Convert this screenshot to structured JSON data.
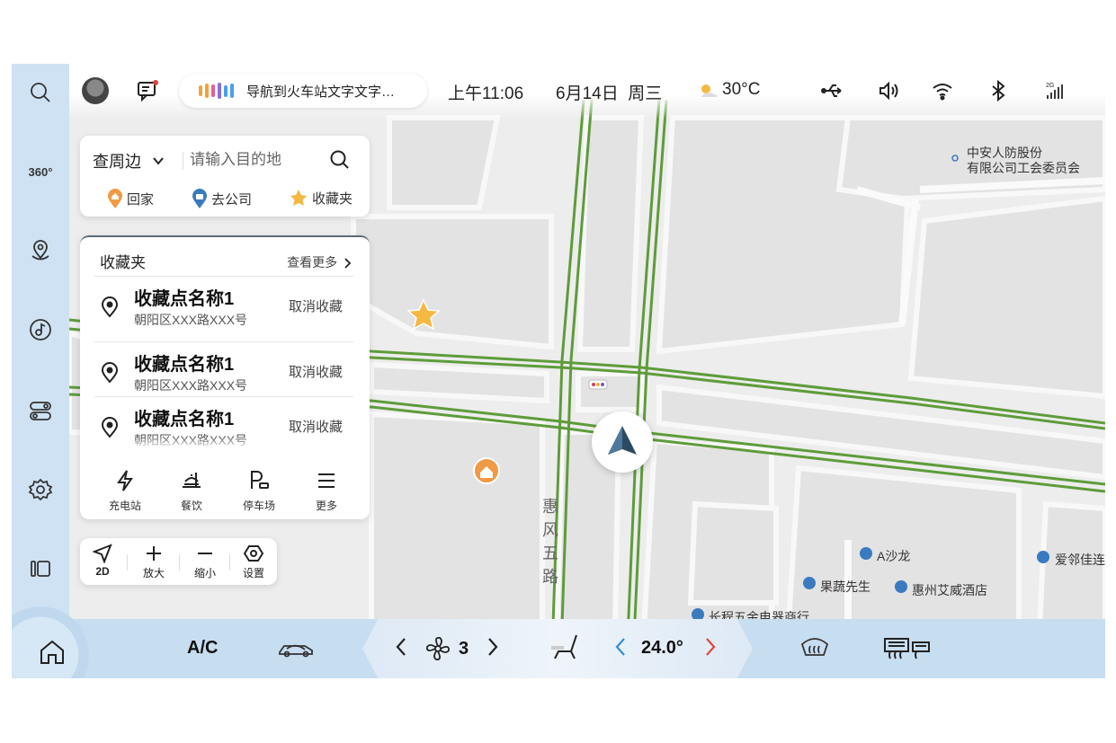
{
  "status_bar": {
    "voice_text": "导航到火车站文字文字…",
    "time": "上午11:06",
    "date": "6月14日  周三",
    "temperature": "30°C"
  },
  "left_rail": {
    "items": [
      "search-icon",
      "360-view",
      "location-pin-icon",
      "music-icon",
      "toggle-settings-icon",
      "gear-icon",
      "apps-icon"
    ],
    "view_360_label": "360°"
  },
  "search": {
    "mode_label": "查周边",
    "placeholder": "请输入目的地",
    "shortcuts": [
      {
        "label": "回家",
        "icon": "home-pin-icon"
      },
      {
        "label": "去公司",
        "icon": "work-pin-icon"
      },
      {
        "label": "收藏夹",
        "icon": "star-icon"
      }
    ]
  },
  "favorites": {
    "title": "收藏夹",
    "more_label": "查看更多",
    "items": [
      {
        "name": "收藏点名称1",
        "address": "朝阳区XXX路XXX号",
        "action": "取消收藏"
      },
      {
        "name": "收藏点名称1",
        "address": "朝阳区XXX路XXX号",
        "action": "取消收藏"
      },
      {
        "name": "收藏点名称1",
        "address": "朝阳区XXX路XXX号",
        "action": "取消收藏"
      }
    ],
    "categories": [
      {
        "label": "充电站",
        "icon": "lightning-icon"
      },
      {
        "label": "餐饮",
        "icon": "food-icon"
      },
      {
        "label": "停车场",
        "icon": "parking-icon"
      },
      {
        "label": "更多",
        "icon": "menu-icon"
      }
    ]
  },
  "map_controls": [
    {
      "label": "2D",
      "icon": "navigate-arrow-icon"
    },
    {
      "label": "放大",
      "icon": "plus-icon"
    },
    {
      "label": "缩小",
      "icon": "minus-icon"
    },
    {
      "label": "设置",
      "icon": "settings-hex-icon"
    }
  ],
  "map": {
    "road_name": "惠风五路",
    "pois": [
      {
        "name": "中安人防股份"
      },
      {
        "name": "有限公司工会委员会"
      },
      {
        "name": "A沙龙"
      },
      {
        "name": "爱邻佳连"
      },
      {
        "name": "果蔬先生"
      },
      {
        "name": "惠州艾威酒店"
      },
      {
        "name": "长程五金电器商行"
      }
    ],
    "road_color": "#5e9c3a"
  },
  "climate": {
    "ac_label": "A/C",
    "fan_level": "3",
    "temperature": "24.0°",
    "accent_left": "#2f8fd8",
    "accent_right": "#e0483a"
  }
}
